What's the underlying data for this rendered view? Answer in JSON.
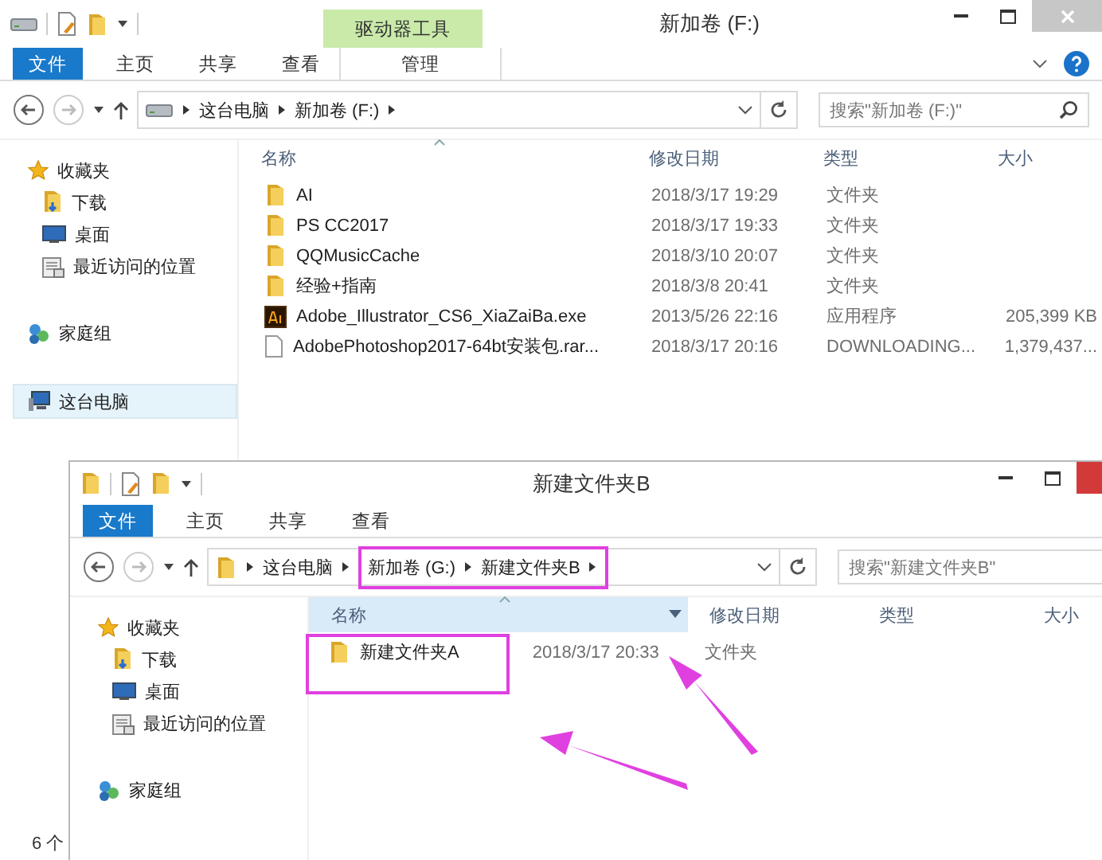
{
  "windows": [
    {
      "title": "新加卷 (F:)",
      "context_tab": "驱动器工具",
      "kind": "drive",
      "ribbon_tabs": [
        {
          "label": "文件",
          "kind": "file"
        },
        {
          "label": "主页",
          "kind": "tab"
        },
        {
          "label": "共享",
          "kind": "tab"
        },
        {
          "label": "查看",
          "kind": "tab"
        },
        {
          "label": "管理",
          "kind": "context"
        }
      ],
      "breadcrumb": [
        {
          "label": "这台电脑",
          "highlighted": false
        },
        {
          "label": "新加卷 (F:)",
          "highlighted": false
        }
      ],
      "search": {
        "placeholder": "搜索\"新加卷 (F:)\""
      },
      "nav": [
        {
          "label": "收藏夹",
          "kind": "favorites",
          "selected": false,
          "children": [
            {
              "label": "下载",
              "kind": "downloads",
              "selected": false
            },
            {
              "label": "桌面",
              "kind": "desktop",
              "selected": false
            },
            {
              "label": "最近访问的位置",
              "kind": "recent",
              "selected": false
            }
          ]
        },
        {
          "label": "家庭组",
          "kind": "homegroup",
          "selected": false
        },
        {
          "label": "这台电脑",
          "kind": "computer",
          "selected": true
        }
      ],
      "columns": [
        {
          "label": "名称",
          "sorted": true,
          "hovered": false
        },
        {
          "label": "修改日期",
          "sorted": false,
          "hovered": false
        },
        {
          "label": "类型",
          "sorted": false,
          "hovered": false
        },
        {
          "label": "大小",
          "sorted": false,
          "hovered": false
        }
      ],
      "rows": [
        {
          "kind": "folder",
          "name": "AI",
          "date": "2018/3/17 19:29",
          "type": "文件夹",
          "highlighted": false
        },
        {
          "kind": "folder",
          "name": "PS CC2017",
          "date": "2018/3/17 19:33",
          "type": "文件夹",
          "highlighted": false
        },
        {
          "kind": "folder",
          "name": "QQMusicCache",
          "date": "2018/3/10 20:07",
          "type": "文件夹",
          "highlighted": false
        },
        {
          "kind": "folder",
          "name": "经验+指南",
          "date": "2018/3/8 20:41",
          "type": "文件夹",
          "highlighted": false
        },
        {
          "kind": "app",
          "name": "Adobe_Illustrator_CS6_XiaZaiBa.exe",
          "date": "2013/5/26 22:16",
          "type": "应用程序",
          "size": "205,399 KB",
          "highlighted": false
        },
        {
          "kind": "file",
          "name": "AdobePhotoshop2017-64bt安装包.rar...",
          "date": "2018/3/17 20:16",
          "type": "DOWNLOADING...",
          "size": "1,379,437...",
          "highlighted": false
        }
      ],
      "status": "6 个"
    },
    {
      "title": "新建文件夹B",
      "kind": "folder",
      "ribbon_tabs": [
        {
          "label": "文件",
          "kind": "file"
        },
        {
          "label": "主页",
          "kind": "tab"
        },
        {
          "label": "共享",
          "kind": "tab"
        },
        {
          "label": "查看",
          "kind": "tab"
        }
      ],
      "breadcrumb": [
        {
          "label": "这台电脑",
          "highlighted": false
        },
        {
          "label": "新加卷 (G:)",
          "highlighted": true
        },
        {
          "label": "新建文件夹B",
          "highlighted": true
        }
      ],
      "search": {
        "placeholder": "搜索\"新建文件夹B\""
      },
      "nav": [
        {
          "label": "收藏夹",
          "kind": "favorites",
          "selected": false,
          "children": [
            {
              "label": "下载",
              "kind": "downloads",
              "selected": false
            },
            {
              "label": "桌面",
              "kind": "desktop",
              "selected": false
            },
            {
              "label": "最近访问的位置",
              "kind": "recent",
              "selected": false
            }
          ]
        },
        {
          "label": "家庭组",
          "kind": "homegroup",
          "selected": false
        }
      ],
      "columns": [
        {
          "label": "名称",
          "sorted": true,
          "hovered": true
        },
        {
          "label": "修改日期",
          "sorted": false,
          "hovered": false
        },
        {
          "label": "类型",
          "sorted": false,
          "hovered": false
        },
        {
          "label": "大小",
          "sorted": false,
          "hovered": false
        }
      ],
      "rows": [
        {
          "kind": "folder",
          "name": "新建文件夹A",
          "date": "2018/3/17 20:33",
          "type": "文件夹",
          "highlighted": true
        }
      ]
    }
  ]
}
